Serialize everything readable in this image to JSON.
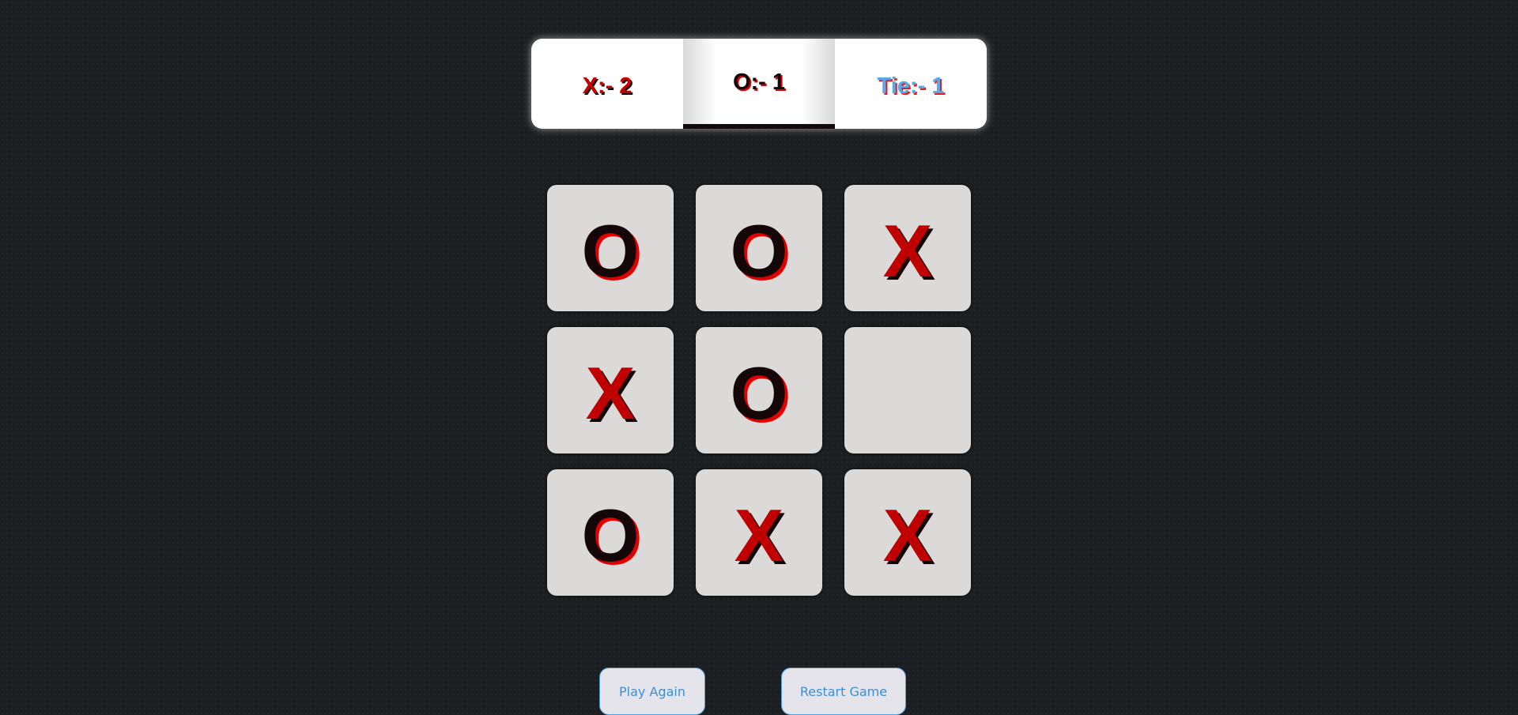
{
  "scoreboard": {
    "x_label": "X:- 2",
    "o_label": "O:- 1",
    "tie_label": "Tie:- 1"
  },
  "board": {
    "cells": [
      "O",
      "O",
      "X",
      "X",
      "O",
      "",
      "O",
      "X",
      "X"
    ]
  },
  "buttons": {
    "play_again": "Play Again",
    "restart_game": "Restart Game"
  },
  "colors": {
    "background": "#1b1f21",
    "x_mark": "#c00000",
    "o_mark": "#150707",
    "cell": "#dcd9d9",
    "button_text": "#3d8fd4"
  }
}
